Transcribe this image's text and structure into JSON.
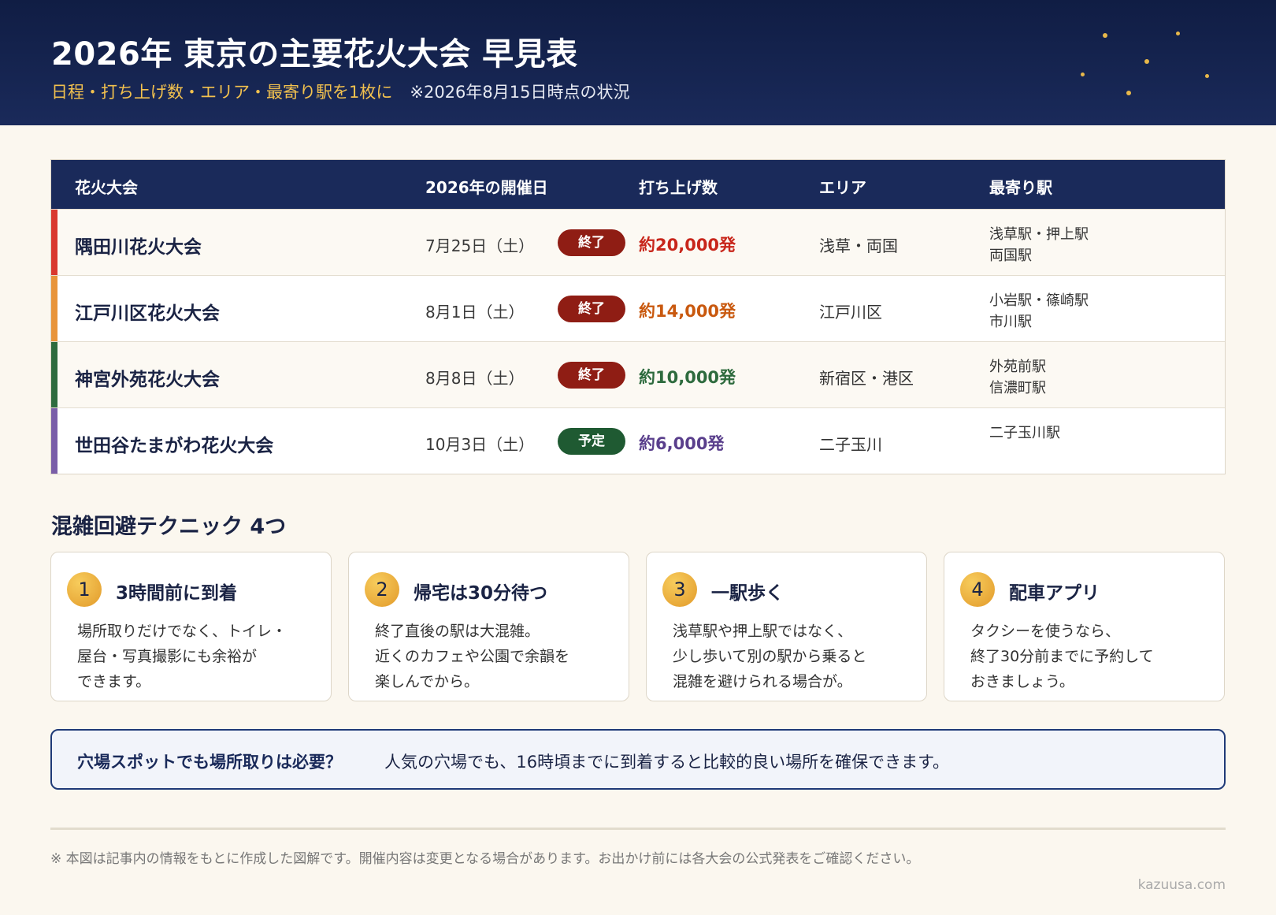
{
  "header": {
    "title": "2026年 東京の主要花火大会 早見表",
    "subtitle": "日程・打ち上げ数・エリア・最寄り駅を1枚に",
    "note": "※2026年8月15日時点の状況"
  },
  "table": {
    "columns": [
      "花火大会",
      "2026年の開催日",
      "打ち上げ数",
      "エリア",
      "最寄り駅"
    ],
    "rows": [
      {
        "name": "隅田川花火大会",
        "date": "7月25日（土）",
        "status": "終了",
        "count": "約20,000発",
        "area": "浅草・両国",
        "station": "浅草駅・押上駅\n両国駅"
      },
      {
        "name": "江戸川区花火大会",
        "date": "8月1日（土）",
        "status": "終了",
        "count": "約14,000発",
        "area": "江戸川区",
        "station": "小岩駅・篠崎駅\n市川駅"
      },
      {
        "name": "神宮外苑花火大会",
        "date": "8月8日（土）",
        "status": "終了",
        "count": "約10,000発",
        "area": "新宿区・港区",
        "station": "外苑前駅\n信濃町駅"
      },
      {
        "name": "世田谷たまがわ花火大会",
        "date": "10月3日（土）",
        "status": "予定",
        "count": "約6,000発",
        "area": "二子玉川",
        "station": "二子玉川駅"
      }
    ]
  },
  "colors": {
    "row_accents": [
      "#d9382e",
      "#e8943a",
      "#2e6b3e",
      "#7a5ea8"
    ],
    "count_colors": [
      "#c8261b",
      "#c9590f",
      "#2e6b3e",
      "#5a3f8c"
    ],
    "status_ended": "#8f1d14",
    "status_planned": "#1f5a32"
  },
  "tips": {
    "title": "混雑回避テクニック 4つ",
    "items": [
      {
        "num": "1",
        "title": "3時間前に到着",
        "body": "場所取りだけでなく、トイレ・\n屋台・写真撮影にも余裕が\nできます。"
      },
      {
        "num": "2",
        "title": "帰宅は30分待つ",
        "body": "終了直後の駅は大混雑。\n近くのカフェや公園で余韻を\n楽しんでから。"
      },
      {
        "num": "3",
        "title": "一駅歩く",
        "body": "浅草駅や押上駅ではなく、\n少し歩いて別の駅から乗ると\n混雑を避けられる場合が。"
      },
      {
        "num": "4",
        "title": "配車アプリ",
        "body": "タクシーを使うなら、\n終了30分前までに予約して\nおきましょう。"
      }
    ]
  },
  "callout": {
    "question": "穴場スポットでも場所取りは必要？",
    "answer": "人気の穴場でも、16時頃までに到着すると比較的良い場所を確保できます。"
  },
  "footer": {
    "note": "※ 本図は記事内の情報をもとに作成した図解です。開催内容は変更となる場合があります。お出かけ前には各大会の公式発表をご確認ください。",
    "credit": "kazuusa.com"
  }
}
